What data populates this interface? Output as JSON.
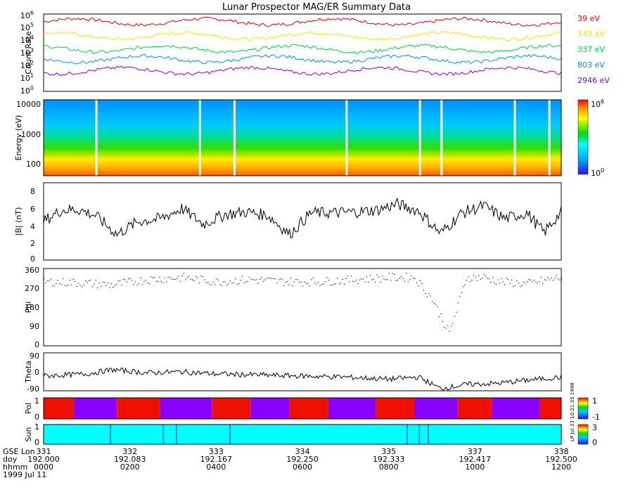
{
  "title": "Lunar Prospector MAG/ER Summary Data",
  "colors": {
    "axis": "#000000",
    "missing": "#ffffff"
  },
  "panels": {
    "count_rate": {
      "ylabel": "Count Rate",
      "yticks": [
        "10",
        "10",
        "10",
        "10",
        "10",
        "10",
        "10"
      ],
      "yexps": [
        "0",
        "1",
        "2",
        "3",
        "4",
        "5",
        "6"
      ],
      "ylim_log10": [
        0,
        6
      ]
    },
    "spectrogram": {
      "ylabel": "Energy (eV)",
      "yticks": [
        "10000",
        "1000",
        "100"
      ],
      "ylim_ev": [
        40,
        16000
      ],
      "colorbar_ticks": [
        "10",
        "10"
      ],
      "colorbar_exps": [
        "0",
        "6"
      ],
      "colorbar_range_log10": [
        0,
        6
      ]
    },
    "bmag": {
      "ylabel": "|B| (nT)",
      "yticks": [
        "0",
        "2",
        "4",
        "6",
        "8"
      ],
      "ylim": [
        0,
        9
      ]
    },
    "phi": {
      "ylabel": "Phi",
      "yticks": [
        "0",
        "90",
        "180",
        "270",
        "360"
      ],
      "ylim": [
        0,
        360
      ]
    },
    "theta": {
      "ylabel": "Theta",
      "yticks": [
        "-90",
        "0",
        "90"
      ],
      "ylim": [
        -90,
        90
      ]
    },
    "pol": {
      "ylabel": "Pol",
      "yticks": [
        "0",
        "1"
      ],
      "cbar_ticks": [
        "1",
        "-1"
      ],
      "side_text": "LP Jul 23 10:21:35 1998"
    },
    "sun": {
      "ylabel": "Sun",
      "yticks": [
        "0",
        "1"
      ],
      "cbar_ticks": [
        "3",
        "0"
      ]
    }
  },
  "xaxis": {
    "row_labels": [
      "GSE Lon",
      "doy",
      "hhmm",
      "1999 Jul 11"
    ],
    "ticks": [
      {
        "lon": "331",
        "doy": "192.000",
        "hhmm": "0000"
      },
      {
        "lon": "332",
        "doy": "192.083",
        "hhmm": "0200"
      },
      {
        "lon": "333",
        "doy": "192.167",
        "hhmm": "0400"
      },
      {
        "lon": "334",
        "doy": "192.250",
        "hhmm": "0600"
      },
      {
        "lon": "335",
        "doy": "192.333",
        "hhmm": "0800"
      },
      {
        "lon": "337",
        "doy": "192.417",
        "hhmm": "1000"
      },
      {
        "lon": "338",
        "doy": "192.500",
        "hhmm": "1200"
      }
    ],
    "range_hours": [
      0,
      12
    ]
  },
  "chart_data": {
    "type": "line",
    "title": "Lunar Prospector MAG/ER Summary Data",
    "x_unit": "hours after 1999 Jul 11 0000",
    "count_rate_series": [
      {
        "name": "39 eV",
        "color": "#dd0000",
        "log10_level": 5.4
      },
      {
        "name": "142 eV",
        "color": "#e8e800",
        "log10_level": 4.3
      },
      {
        "name": "337 eV",
        "color": "#00cc44",
        "log10_level": 3.3
      },
      {
        "name": "803 eV",
        "color": "#0090d0",
        "log10_level": 2.5
      },
      {
        "name": "2946 eV",
        "color": "#8800cc",
        "log10_level": 1.6
      }
    ],
    "bmag_nT": {
      "x": [
        0,
        0.4,
        0.8,
        1.2,
        1.7,
        2.2,
        2.7,
        3.2,
        3.7,
        4.2,
        4.7,
        5.2,
        5.7,
        6.2,
        6.7,
        7.2,
        7.7,
        8.2,
        8.7,
        9.2,
        9.7,
        10.2,
        10.7,
        11.2,
        11.6,
        12
      ],
      "y": [
        4.5,
        5.8,
        5.9,
        5.2,
        3.0,
        4.5,
        4.8,
        6.0,
        4.2,
        5.3,
        5.6,
        5.2,
        3.0,
        5.5,
        5.5,
        5.6,
        5.8,
        6.5,
        5.7,
        3.1,
        5.5,
        6.3,
        4.8,
        5.5,
        3.2,
        5.6
      ]
    },
    "phi_deg": {
      "x": [
        0,
        0.8,
        1.6,
        2.4,
        3.2,
        4.0,
        4.8,
        5.6,
        6.4,
        7.2,
        8.0,
        8.6,
        9.0,
        9.4,
        9.8,
        10.2,
        10.6,
        11.2,
        12
      ],
      "y": [
        300,
        295,
        285,
        310,
        320,
        300,
        310,
        300,
        300,
        310,
        320,
        320,
        220,
        60,
        320,
        320,
        300,
        290,
        320
      ]
    },
    "theta_deg": {
      "x": [
        0,
        1,
        1.6,
        2.4,
        3.2,
        4.0,
        5.0,
        6.0,
        7.0,
        8.0,
        8.7,
        9.2,
        9.8,
        10.5,
        11.2,
        12
      ],
      "y": [
        -20,
        -10,
        10,
        -5,
        0,
        -10,
        -15,
        -20,
        -25,
        -35,
        -25,
        -80,
        -60,
        -55,
        -40,
        -25
      ]
    },
    "pol_segments": [
      {
        "x0": 0.0,
        "x1": 0.7,
        "value": 1
      },
      {
        "x0": 0.7,
        "x1": 1.7,
        "value": 0
      },
      {
        "x0": 1.7,
        "x1": 2.7,
        "value": 1
      },
      {
        "x0": 2.7,
        "x1": 3.9,
        "value": 0
      },
      {
        "x0": 3.9,
        "x1": 4.8,
        "value": 1
      },
      {
        "x0": 4.8,
        "x1": 5.7,
        "value": 0
      },
      {
        "x0": 5.7,
        "x1": 6.6,
        "value": 1
      },
      {
        "x0": 6.6,
        "x1": 7.7,
        "value": 0
      },
      {
        "x0": 7.7,
        "x1": 8.6,
        "value": 1
      },
      {
        "x0": 8.6,
        "x1": 9.6,
        "value": 0
      },
      {
        "x0": 9.6,
        "x1": 10.4,
        "value": 1
      },
      {
        "x0": 10.4,
        "x1": 11.5,
        "value": 0
      },
      {
        "x0": 11.5,
        "x1": 12.0,
        "value": 1
      }
    ],
    "sun_level": 1
  }
}
